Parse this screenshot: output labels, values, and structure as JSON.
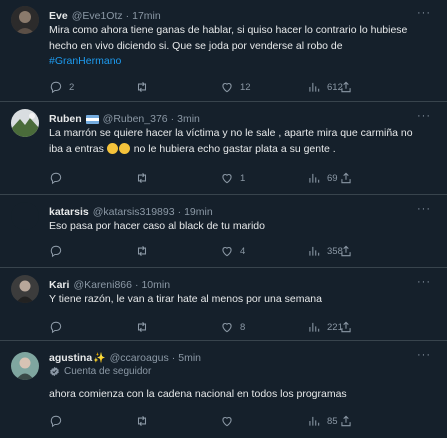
{
  "tweets": [
    {
      "name": "Eve",
      "handle": "@Eve1Otz",
      "time": "17min",
      "text_parts": [
        "Mira como ahora tiene ganas de hablar, si quiso hacer lo contrario lo hubiese hecho en vivo diciendo si. Que se joda por venderse al robo de ",
        "#GranHermano"
      ],
      "replies": "2",
      "retweets": "",
      "likes": "12",
      "views": "612"
    },
    {
      "name": "Ruben",
      "handle": "@Ruben_376",
      "time": "3min",
      "text_before": "La marrón se quiere hacer la víctima y no le sale , aparte mira que carmiña no iba a entras ",
      "text_after": " no le hubiera echo gastar plata a su gente .",
      "replies": "",
      "retweets": "",
      "likes": "1",
      "views": "69"
    },
    {
      "name": "katarsis",
      "handle": "@katarsis319893",
      "time": "19min",
      "text": "Eso pasa por hacer caso al black de tu marido",
      "replies": "",
      "retweets": "",
      "likes": "4",
      "views": "358"
    },
    {
      "name": "Kari",
      "handle": "@Kareni866",
      "time": "10min",
      "text": "Y tiene razón, le van a tirar hate al menos por una semana",
      "replies": "",
      "retweets": "",
      "likes": "8",
      "views": "221"
    },
    {
      "name": "agustina",
      "name_suffix": "✨",
      "handle": "@ccaroagus",
      "time": "5min",
      "follower_label": "Cuenta de seguidor",
      "text": "ahora comienza con la cadena nacional en todos los programas",
      "replies": "",
      "retweets": "",
      "likes": "",
      "views": "85"
    }
  ],
  "separator": "·",
  "colors": {
    "background": "#15202b",
    "text": "#e7e9ea",
    "muted": "#8b98a5",
    "link": "#1d9bf0",
    "divider": "#38444d"
  },
  "icons": [
    "reply-icon",
    "retweet-icon",
    "like-icon",
    "views-icon",
    "share-icon",
    "more-icon",
    "verified-badge-icon",
    "flag-icon",
    "sparkles-icon",
    "laughing-emoji-icon"
  ]
}
